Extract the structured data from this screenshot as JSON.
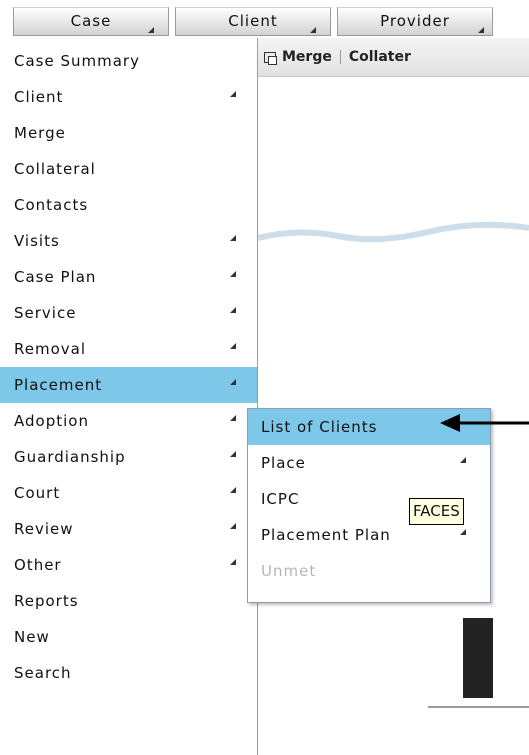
{
  "topbar": {
    "tabs": [
      {
        "label": "Case"
      },
      {
        "label": "Client"
      },
      {
        "label": "Provider"
      }
    ]
  },
  "background_page": {
    "toolbar_items": [
      "Merge",
      "Collater"
    ]
  },
  "case_menu": {
    "items": [
      {
        "label": "Case Summary",
        "submenu": false
      },
      {
        "label": "Client",
        "submenu": true
      },
      {
        "label": "Merge",
        "submenu": false
      },
      {
        "label": "Collateral",
        "submenu": false
      },
      {
        "label": "Contacts",
        "submenu": false
      },
      {
        "label": "Visits",
        "submenu": true
      },
      {
        "label": "Case Plan",
        "submenu": true
      },
      {
        "label": "Service",
        "submenu": true
      },
      {
        "label": "Removal",
        "submenu": true
      },
      {
        "label": "Placement",
        "submenu": true,
        "highlighted": true
      },
      {
        "label": "Adoption",
        "submenu": true
      },
      {
        "label": "Guardianship",
        "submenu": true
      },
      {
        "label": "Court",
        "submenu": true
      },
      {
        "label": "Review",
        "submenu": true
      },
      {
        "label": "Other",
        "submenu": true
      },
      {
        "label": "Reports",
        "submenu": false
      },
      {
        "label": "New",
        "submenu": false
      },
      {
        "label": "Search",
        "submenu": false
      }
    ]
  },
  "placement_submenu": {
    "items": [
      {
        "label": "List of Clients",
        "submenu": false,
        "highlighted": true
      },
      {
        "label": "Place",
        "submenu": true
      },
      {
        "label": "ICPC",
        "submenu": false
      },
      {
        "label": "Placement Plan",
        "submenu": true
      },
      {
        "label": "Unmet",
        "disabled": true
      }
    ]
  },
  "tooltip": {
    "text": "FACES"
  },
  "colors": {
    "highlight": "#7dc8e8",
    "menu_border": "#8b9eb4",
    "disabled": "#b6b6b6",
    "tooltip_bg": "#ffffe1"
  }
}
